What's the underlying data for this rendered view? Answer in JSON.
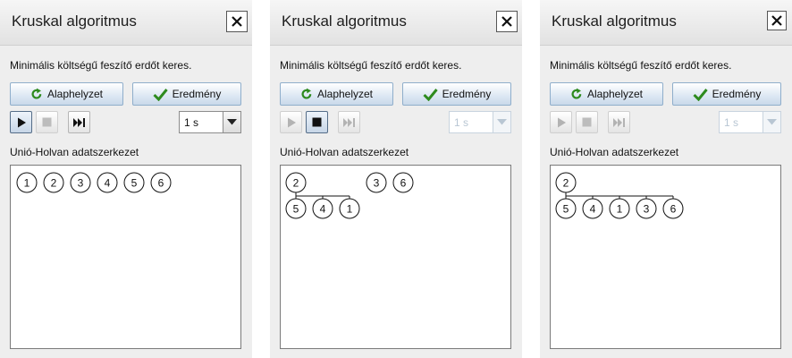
{
  "panels": [
    {
      "title": "Kruskal algoritmus",
      "description": "Minimális költségű feszítő erdőt keres.",
      "reset_label": "Alaphelyzet",
      "result_label": "Eredmény",
      "speed_value": "1 s",
      "section_label": "Unió-Holvan adatszerkezet",
      "state": {
        "play": "active",
        "stop": "disabled",
        "step": "enabled",
        "speed": "enabled"
      },
      "trees": [
        {
          "root": "1",
          "children": []
        },
        {
          "root": "2",
          "children": []
        },
        {
          "root": "3",
          "children": []
        },
        {
          "root": "4",
          "children": []
        },
        {
          "root": "5",
          "children": []
        },
        {
          "root": "6",
          "children": []
        }
      ]
    },
    {
      "title": "Kruskal algoritmus",
      "description": "Minimális költségű feszítő erdőt keres.",
      "reset_label": "Alaphelyzet",
      "result_label": "Eredmény",
      "speed_value": "1 s",
      "section_label": "Unió-Holvan adatszerkezet",
      "state": {
        "play": "disabled",
        "stop": "active",
        "step": "disabled",
        "speed": "disabled"
      },
      "trees": [
        {
          "root": "2",
          "children": [
            "5",
            "4",
            "1"
          ]
        },
        {
          "root": "3",
          "children": []
        },
        {
          "root": "6",
          "children": []
        }
      ]
    },
    {
      "title": "Kruskal algoritmus",
      "description": "Minimális költségű feszítő erdőt keres.",
      "reset_label": "Alaphelyzet",
      "result_label": "Eredmény",
      "speed_value": "1 s",
      "section_label": "Unió-Holvan adatszerkezet",
      "state": {
        "play": "disabled",
        "stop": "disabled",
        "step": "disabled",
        "speed": "disabled"
      },
      "trees": [
        {
          "root": "2",
          "children": [
            "5",
            "4",
            "1",
            "3",
            "6"
          ]
        }
      ]
    }
  ],
  "icons": {
    "close": "close-x-icon",
    "reset": "refresh-icon",
    "result": "checkmark-icon",
    "play": "play-icon",
    "stop": "stop-icon",
    "step": "fast-forward-icon",
    "dropdown": "chevron-down-icon"
  },
  "colors": {
    "reset_icon": "#2e8b1e",
    "result_icon": "#2e8b1e",
    "button_border": "#8faecb",
    "disabled_icon": "#b3b3b3"
  }
}
